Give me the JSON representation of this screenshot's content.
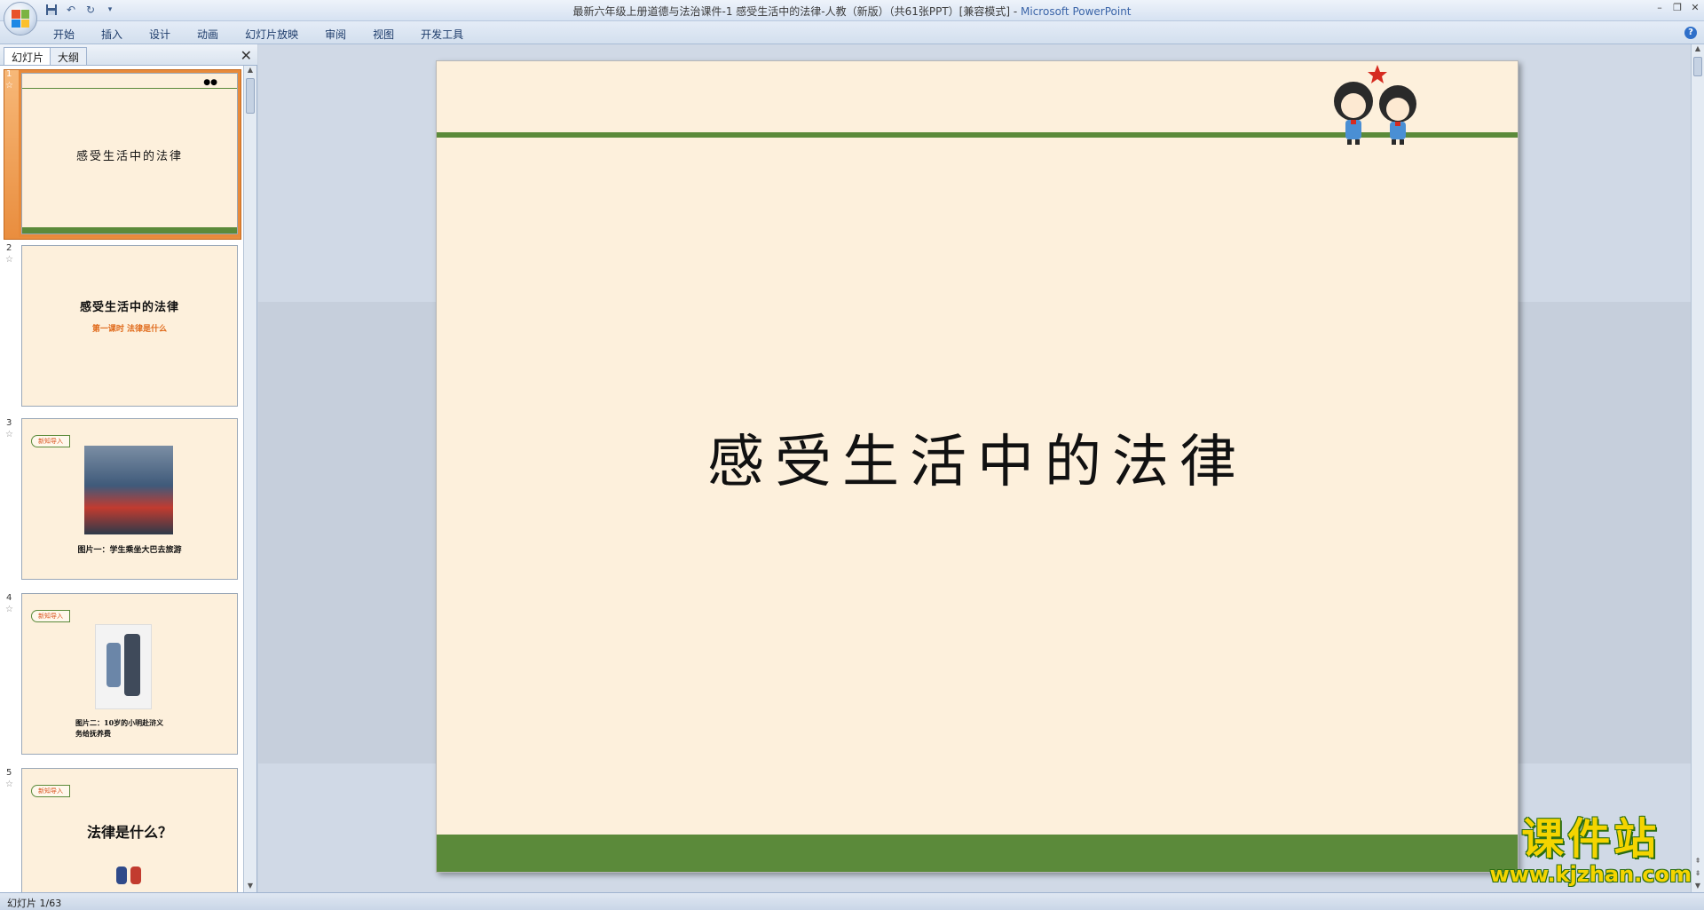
{
  "window": {
    "title": "最新六年级上册道德与法治课件-1 感受生活中的法律-人教（新版）（共61张PPT）[兼容模式]",
    "title_separator": " - ",
    "app_name": "Microsoft PowerPoint"
  },
  "ribbon": {
    "tabs": [
      "开始",
      "插入",
      "设计",
      "动画",
      "幻灯片放映",
      "审阅",
      "视图",
      "开发工具"
    ]
  },
  "panel": {
    "tabs": [
      "幻灯片",
      "大纲"
    ]
  },
  "thumbnails": [
    {
      "num": "1",
      "title": "感受生活中的法律"
    },
    {
      "num": "2",
      "title": "感受生活中的法律",
      "subtitle": "第一课时  法律是什么"
    },
    {
      "num": "3",
      "tag": "新知导入",
      "caption": "图片一：学生乘坐大巴去旅游"
    },
    {
      "num": "4",
      "tag": "新知导入",
      "caption_line1": "图片二：10岁的小明赴浒义",
      "caption_line2": "务给抚养费"
    },
    {
      "num": "5",
      "tag": "新知导入",
      "title": "法律是什么？"
    }
  ],
  "slide": {
    "title": "感受生活中的法律"
  },
  "watermark": {
    "brand": "课件站",
    "url": "www.kjzhan.com"
  },
  "status": {
    "slide_info": "幻灯片 1/63"
  },
  "colors": {
    "slide_bg": "#fdf0dc",
    "accent_green": "#5b8a3a",
    "selection_orange": "#e98d3e",
    "tag_text": "#d9531e"
  }
}
